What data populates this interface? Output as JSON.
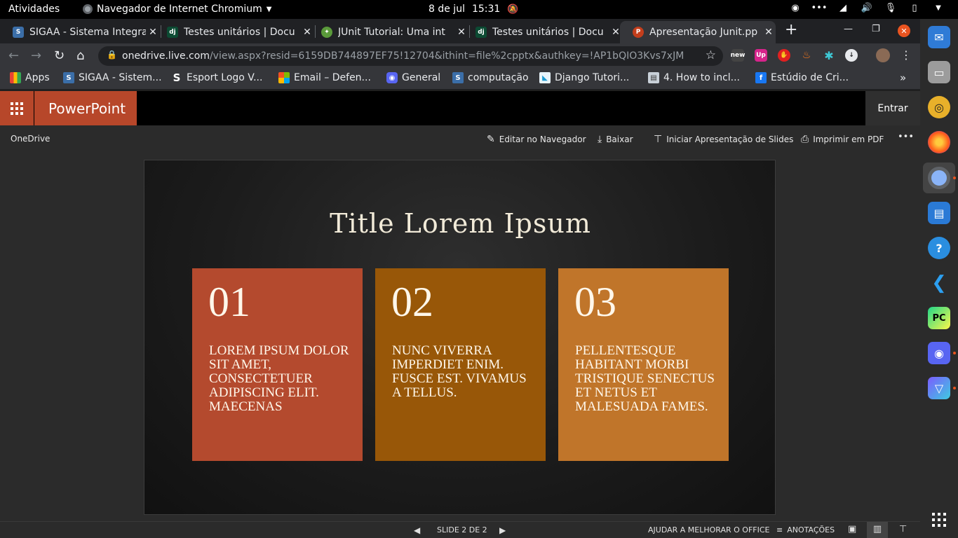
{
  "os_topbar": {
    "activities": "Atividades",
    "app_menu": "Navegador de Internet Chromium",
    "date": "8 de jul",
    "time": "15:31"
  },
  "browser": {
    "tabs": [
      {
        "title": "SIGAA - Sistema Integra",
        "active": false
      },
      {
        "title": "Testes unitários | Docu",
        "active": false
      },
      {
        "title": "JUnit Tutorial: Uma int",
        "active": false
      },
      {
        "title": "Testes unitários | Docu",
        "active": false
      },
      {
        "title": "Apresentação Junit.pp",
        "active": true
      }
    ],
    "url_host": "onedrive.live.com",
    "url_rest": "/view.aspx?resid=6159DB744897EF75!12704&ithint=file%2cpptx&authkey=!AP1bQIO3Kvs7xJM",
    "bookmarks": [
      {
        "label": "Apps"
      },
      {
        "label": "SIGAA - Sistem..."
      },
      {
        "label": "Esport Logo V..."
      },
      {
        "label": "Email – Defen..."
      },
      {
        "label": "General"
      },
      {
        "label": "computação"
      },
      {
        "label": "Django Tutori..."
      },
      {
        "label": "4. How to incl..."
      },
      {
        "label": "Estúdio de Cri..."
      }
    ],
    "extensions": [
      "new",
      "Up",
      "",
      "",
      "",
      ""
    ]
  },
  "office": {
    "app_name": "PowerPoint",
    "sign_in": "Entrar",
    "breadcrumb": "OneDrive",
    "commands": {
      "edit": "Editar no Navegador",
      "download": "Baixar",
      "present": "Iniciar Apresentação de Slides",
      "print": "Imprimir em PDF",
      "more": "•••"
    }
  },
  "slide": {
    "title": "Title Lorem Ipsum",
    "cards": [
      {
        "number": "01",
        "text": "LOREM IPSUM DOLOR SIT AMET, CONSECTETUER ADIPISCING ELIT. MAECENAS",
        "color": "#b44a2e"
      },
      {
        "number": "02",
        "text": "NUNC VIVERRA IMPERDIET ENIM. FUSCE EST. VIVAMUS A TELLUS.",
        "color": "#985708"
      },
      {
        "number": "03",
        "text": "PELLENTESQUE HABITANT MORBI TRISTIQUE SENECTUS ET NETUS ET MALESUADA FAMES.",
        "color": "#c0752a"
      }
    ]
  },
  "statusbar": {
    "slide_indicator": "SLIDE 2 DE 2",
    "help_improve": "AJUDAR A MELHORAR O OFFICE",
    "notes": "ANOTAÇÕES"
  },
  "colors": {
    "powerpoint_accent": "#b7472a",
    "office_background": "#2b2b2b"
  }
}
